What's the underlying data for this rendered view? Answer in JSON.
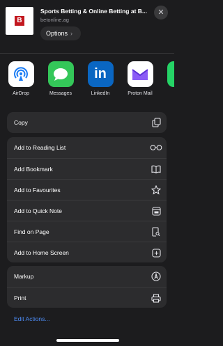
{
  "header": {
    "logo_letter": "B",
    "title": "Sports Betting & Online Betting at B...",
    "url": "betonline.ag",
    "options_label": "Options",
    "options_chevron": "›",
    "close_glyph": "✕"
  },
  "apps": [
    {
      "label": "AirDrop",
      "icon": "airdrop-icon"
    },
    {
      "label": "Messages",
      "icon": "messages-icon"
    },
    {
      "label": "LinkedIn",
      "icon": "linkedin-icon",
      "glyph": "in"
    },
    {
      "label": "Proton Mail",
      "icon": "proton-mail-icon"
    },
    {
      "label": "Wh",
      "icon": "whatsapp-icon"
    }
  ],
  "actions_group1": [
    {
      "label": "Copy",
      "icon": "copy-icon"
    }
  ],
  "actions_group2": [
    {
      "label": "Add to Reading List",
      "icon": "glasses-icon"
    },
    {
      "label": "Add Bookmark",
      "icon": "book-icon"
    },
    {
      "label": "Add to Favourites",
      "icon": "star-icon"
    },
    {
      "label": "Add to Quick Note",
      "icon": "quick-note-icon"
    },
    {
      "label": "Find on Page",
      "icon": "find-icon"
    },
    {
      "label": "Add to Home Screen",
      "icon": "plus-square-icon"
    }
  ],
  "actions_group3": [
    {
      "label": "Markup",
      "icon": "markup-icon"
    },
    {
      "label": "Print",
      "icon": "print-icon"
    }
  ],
  "edit_actions_label": "Edit Actions...",
  "colors": {
    "background": "#1c1c1e",
    "row_bg": "#2c2c2e",
    "accent_link": "#4d8cf5",
    "linkedin": "#0a66c2",
    "messages": "#34c759",
    "airdrop": "#1a7cf5"
  }
}
